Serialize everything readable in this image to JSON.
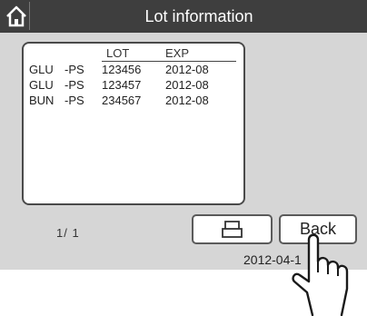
{
  "header": {
    "title": "Lot information",
    "home_icon": "home-icon"
  },
  "table": {
    "columns": [
      "",
      "",
      "LOT",
      "EXP"
    ],
    "rows": [
      [
        "GLU",
        "-PS",
        "123456",
        "2012-08"
      ],
      [
        "GLU",
        "-PS",
        "123457",
        "2012-08"
      ],
      [
        "BUN",
        "-PS",
        "234567",
        "2012-08"
      ]
    ]
  },
  "pagination": {
    "text": "1/ 1"
  },
  "buttons": {
    "print_icon": "printer-icon",
    "back_label": "Back"
  },
  "status": {
    "datetime": "2012-04-1"
  },
  "overlay": {
    "icon": "hand-pointer-icon"
  }
}
